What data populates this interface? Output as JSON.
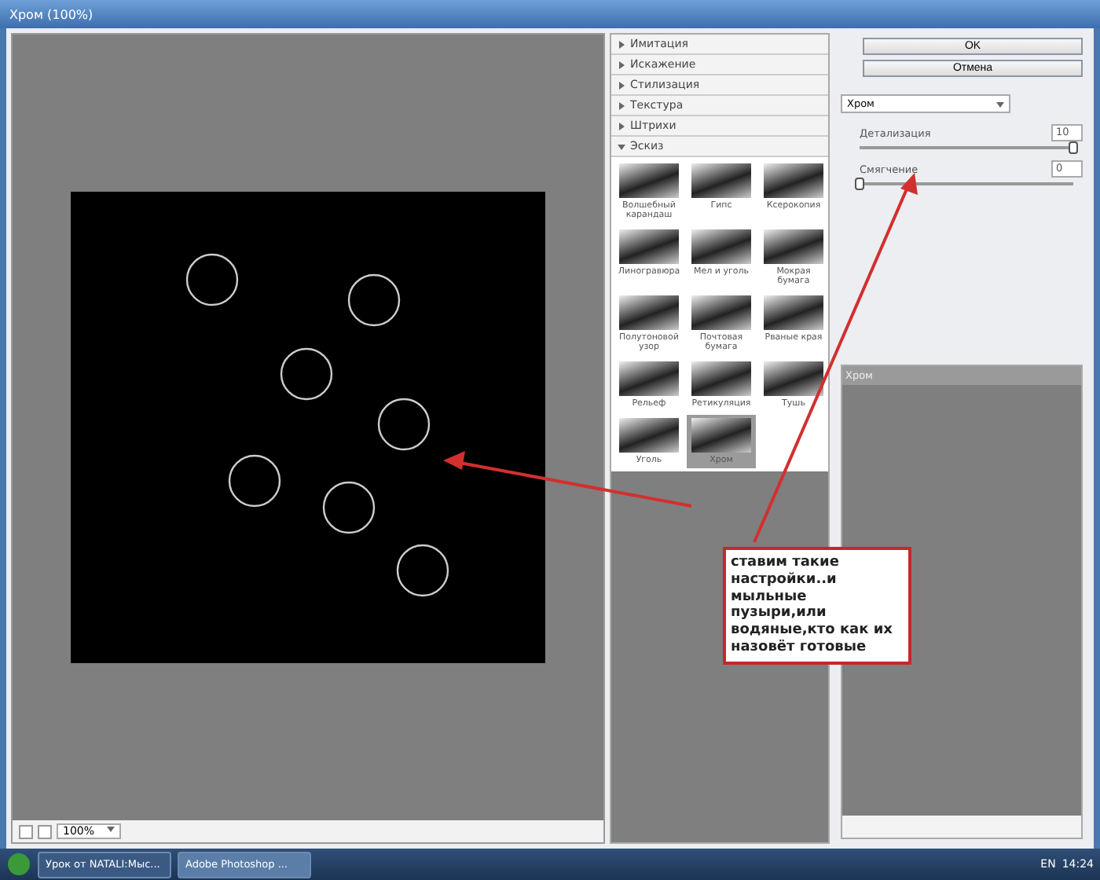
{
  "window": {
    "title": "Хром (100%)"
  },
  "preview": {
    "zoom": "100%"
  },
  "gallery": {
    "categories": [
      {
        "label": "Имитация",
        "expanded": false
      },
      {
        "label": "Искажение",
        "expanded": false
      },
      {
        "label": "Стилизация",
        "expanded": false
      },
      {
        "label": "Текстура",
        "expanded": false
      },
      {
        "label": "Штрихи",
        "expanded": false
      },
      {
        "label": "Эскиз",
        "expanded": true
      }
    ],
    "filters": [
      {
        "label": "Волшебный карандаш",
        "selected": false
      },
      {
        "label": "Гипс",
        "selected": false
      },
      {
        "label": "Ксерокопия",
        "selected": false
      },
      {
        "label": "Линогравюра",
        "selected": false
      },
      {
        "label": "Мел и уголь",
        "selected": false
      },
      {
        "label": "Мокрая бумага",
        "selected": false
      },
      {
        "label": "Полутоновой узор",
        "selected": false
      },
      {
        "label": "Почтовая бумага",
        "selected": false
      },
      {
        "label": "Рваные края",
        "selected": false
      },
      {
        "label": "Рельеф",
        "selected": false
      },
      {
        "label": "Ретикуляция",
        "selected": false
      },
      {
        "label": "Тушь",
        "selected": false
      },
      {
        "label": "Уголь",
        "selected": false
      },
      {
        "label": "Хром",
        "selected": true
      }
    ]
  },
  "settings": {
    "ok": "OK",
    "cancel": "Отмена",
    "filter": "Хром",
    "sliders": [
      {
        "label": "Детализация",
        "value": "10",
        "level": 1
      },
      {
        "label": "Смягчение",
        "value": "0",
        "level": 0
      }
    ]
  },
  "layers": {
    "layer": "Хром"
  },
  "annotation": {
    "text": "ставим такие настройки..и мыльные пузыри,или водяные,кто как их назовёт готовые"
  },
  "taskbar": {
    "items": [
      {
        "label": "Урок от NATALI:Мыс...",
        "selected": false
      },
      {
        "label": "Adobe Photoshop ...",
        "selected": true
      }
    ],
    "language": "EN",
    "time": "14:24"
  }
}
